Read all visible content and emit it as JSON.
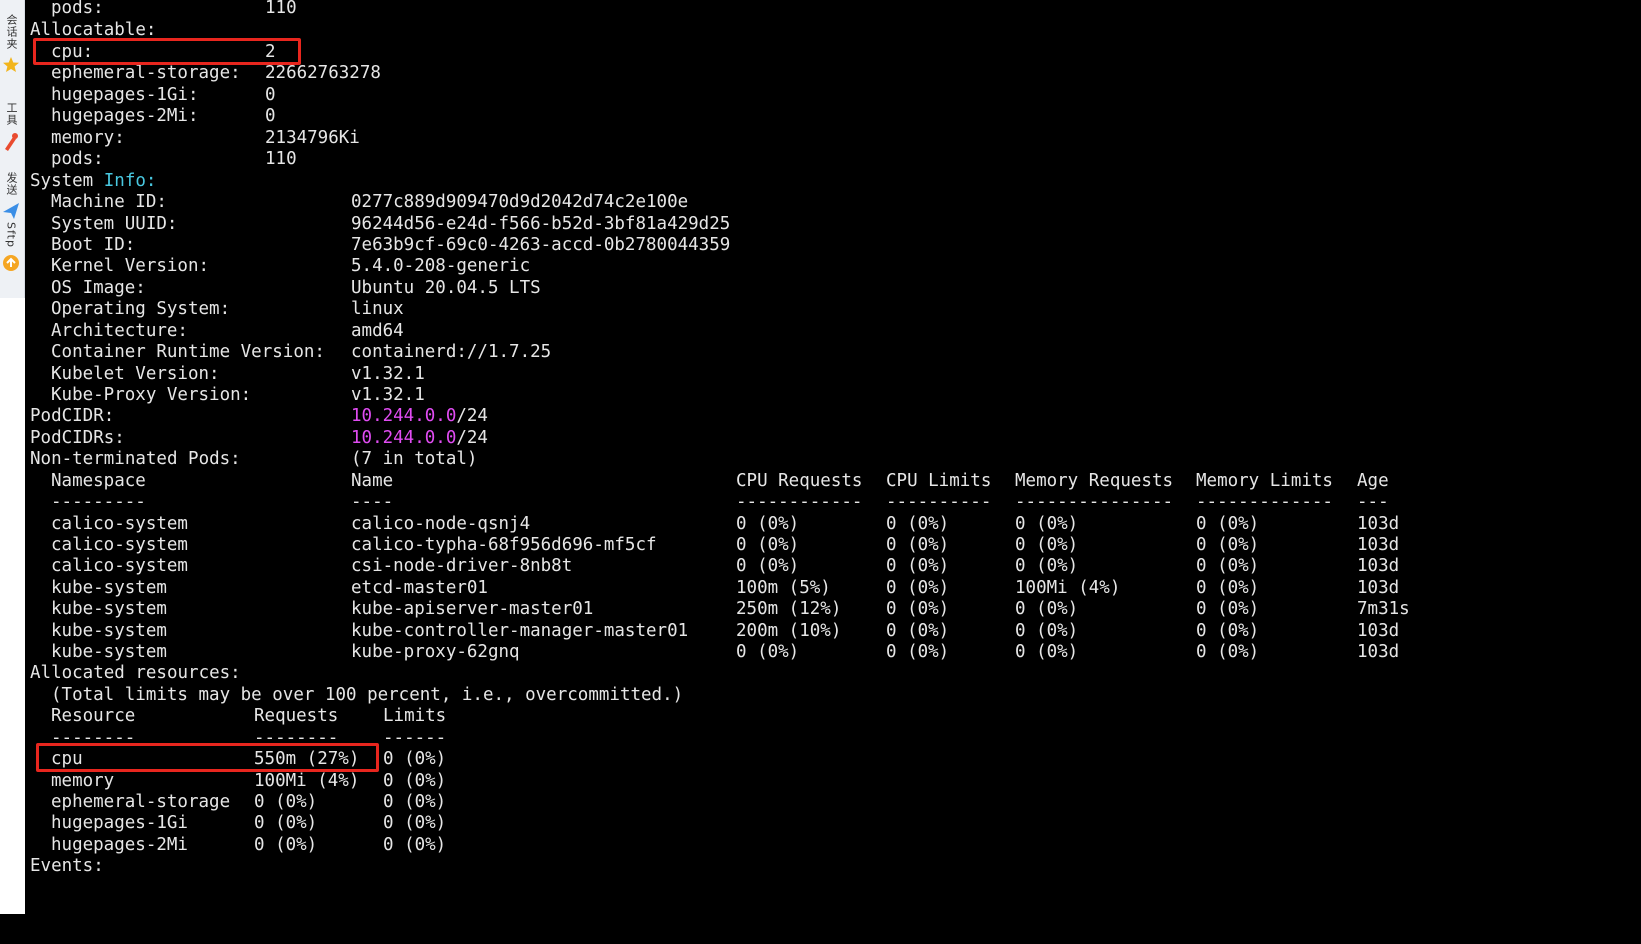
{
  "sidebar": {
    "tabs": [
      {
        "label": "会话夹",
        "icon": "star-icon"
      },
      {
        "label": "工具",
        "icon": "tool-icon"
      },
      {
        "label": "发送",
        "icon": "send-icon"
      },
      {
        "label": "Sftp",
        "icon": "sftp-icon"
      }
    ]
  },
  "terminal": {
    "capacity_pods": {
      "key": "pods:",
      "value": "110"
    },
    "allocatable_header": "Allocatable:",
    "allocatable": [
      {
        "key": "cpu:",
        "value": "2"
      },
      {
        "key": "ephemeral-storage:",
        "value": "22662763278"
      },
      {
        "key": "hugepages-1Gi:",
        "value": "0"
      },
      {
        "key": "hugepages-2Mi:",
        "value": "0"
      },
      {
        "key": "memory:",
        "value": "2134796Ki"
      },
      {
        "key": "pods:",
        "value": "110"
      }
    ],
    "system_info_header": {
      "part1": "System ",
      "part2": "Info",
      "part3": ":"
    },
    "system_info": [
      {
        "key": "Machine ID:",
        "value": "0277c889d909470d9d2042d74c2e100e"
      },
      {
        "key": "System UUID:",
        "value": "96244d56-e24d-f566-b52d-3bf81a429d25"
      },
      {
        "key": "Boot ID:",
        "value": "7e63b9cf-69c0-4263-accd-0b2780044359"
      },
      {
        "key": "Kernel Version:",
        "value": "5.4.0-208-generic"
      },
      {
        "key": "OS Image:",
        "value": "Ubuntu 20.04.5 LTS"
      },
      {
        "key": "Operating System:",
        "value": "linux"
      },
      {
        "key": "Architecture:",
        "value": "amd64"
      },
      {
        "key": "Container Runtime Version:",
        "value": "containerd://1.7.25"
      },
      {
        "key": "Kubelet Version:",
        "value": "v1.32.1"
      },
      {
        "key": "Kube-Proxy Version:",
        "value": "v1.32.1"
      }
    ],
    "podcidr": {
      "key": "PodCIDR:",
      "ip": "10.244.0.0",
      "suffix": "/24"
    },
    "podcidrs": {
      "key": "PodCIDRs:",
      "ip": "10.244.0.0",
      "suffix": "/24"
    },
    "nonterm": {
      "key": "Non-terminated Pods:",
      "value": "(7 in total)"
    },
    "pods_table": {
      "headers": [
        "Namespace",
        "Name",
        "CPU Requests",
        "CPU Limits",
        "Memory Requests",
        "Memory Limits",
        "Age"
      ],
      "dashes": [
        "---------",
        "----",
        "------------",
        "----------",
        "---------------",
        "-------------",
        "---"
      ],
      "rows": [
        [
          "calico-system",
          "calico-node-qsnj4",
          "0 (0%)",
          "0 (0%)",
          "0 (0%)",
          "0 (0%)",
          "103d"
        ],
        [
          "calico-system",
          "calico-typha-68f956d696-mf5cf",
          "0 (0%)",
          "0 (0%)",
          "0 (0%)",
          "0 (0%)",
          "103d"
        ],
        [
          "calico-system",
          "csi-node-driver-8nb8t",
          "0 (0%)",
          "0 (0%)",
          "0 (0%)",
          "0 (0%)",
          "103d"
        ],
        [
          "kube-system",
          "etcd-master01",
          "100m (5%)",
          "0 (0%)",
          "100Mi (4%)",
          "0 (0%)",
          "103d"
        ],
        [
          "kube-system",
          "kube-apiserver-master01",
          "250m (12%)",
          "0 (0%)",
          "0 (0%)",
          "0 (0%)",
          "7m31s"
        ],
        [
          "kube-system",
          "kube-controller-manager-master01",
          "200m (10%)",
          "0 (0%)",
          "0 (0%)",
          "0 (0%)",
          "103d"
        ],
        [
          "kube-system",
          "kube-proxy-62gnq",
          "0 (0%)",
          "0 (0%)",
          "0 (0%)",
          "0 (0%)",
          "103d"
        ]
      ]
    },
    "allocated_header": "Allocated resources:",
    "allocated_note": "(Total limits may be over 100 percent, i.e., overcommitted.)",
    "resources_table": {
      "headers": [
        "Resource",
        "Requests",
        "Limits"
      ],
      "dashes": [
        "--------",
        "--------",
        "------"
      ],
      "rows": [
        [
          "cpu",
          "550m (27%)",
          "0 (0%)"
        ],
        [
          "memory",
          "100Mi (4%)",
          "0 (0%)"
        ],
        [
          "ephemeral-storage",
          "0 (0%)",
          "0 (0%)"
        ],
        [
          "hugepages-1Gi",
          "0 (0%)",
          "0 (0%)"
        ],
        [
          "hugepages-2Mi",
          "0 (0%)",
          "0 (0%)"
        ]
      ]
    },
    "events_header": "Events:"
  },
  "colors": {
    "background": "#000000",
    "foreground": "#e6e6e6",
    "cyan": "#49c8e0",
    "magenta": "#e04cf2",
    "highlight_box": "#e8261e"
  }
}
